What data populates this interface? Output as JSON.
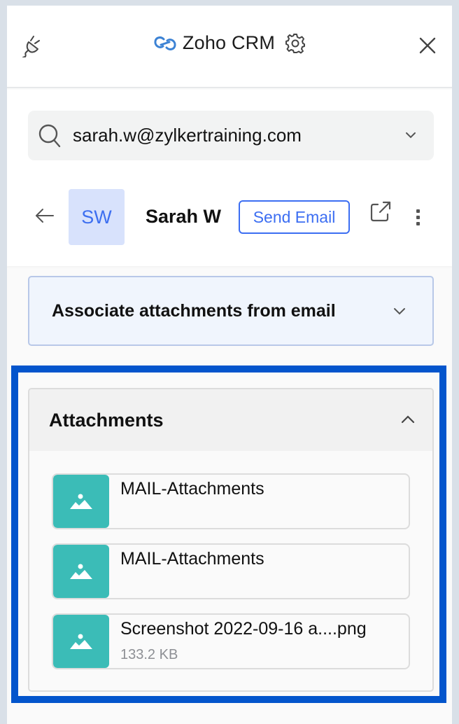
{
  "header": {
    "title": "Zoho CRM",
    "icons": {
      "left": "plug-icon",
      "logo": "zoho-logo-icon",
      "settings": "gear-icon",
      "close": "close-icon"
    }
  },
  "search": {
    "value": "sarah.w@zylkertraining.com",
    "placeholder": "",
    "icon": "search-icon",
    "dropdown_icon": "chevron-down-icon"
  },
  "contact": {
    "initials": "SW",
    "name": "Sarah W",
    "send_email_label": "Send Email",
    "icons": {
      "back": "arrow-left-icon",
      "open": "external-link-icon",
      "more": "more-vertical-icon"
    }
  },
  "associate_section": {
    "label": "Associate attachments from email",
    "expanded": false
  },
  "attachments_section": {
    "label": "Attachments",
    "expanded": true,
    "items": [
      {
        "name": "MAIL-Attachments",
        "size": "",
        "icon": "image-icon"
      },
      {
        "name": "MAIL-Attachments",
        "size": "",
        "icon": "image-icon"
      },
      {
        "name": "Screenshot 2022-09-16 a....png",
        "size": "133.2 KB",
        "icon": "image-icon"
      }
    ]
  },
  "colors": {
    "accent": "#3c6ef2",
    "highlight": "#0355cc",
    "thumbnail": "#3bbcb7",
    "background": "#d9e0e8"
  }
}
